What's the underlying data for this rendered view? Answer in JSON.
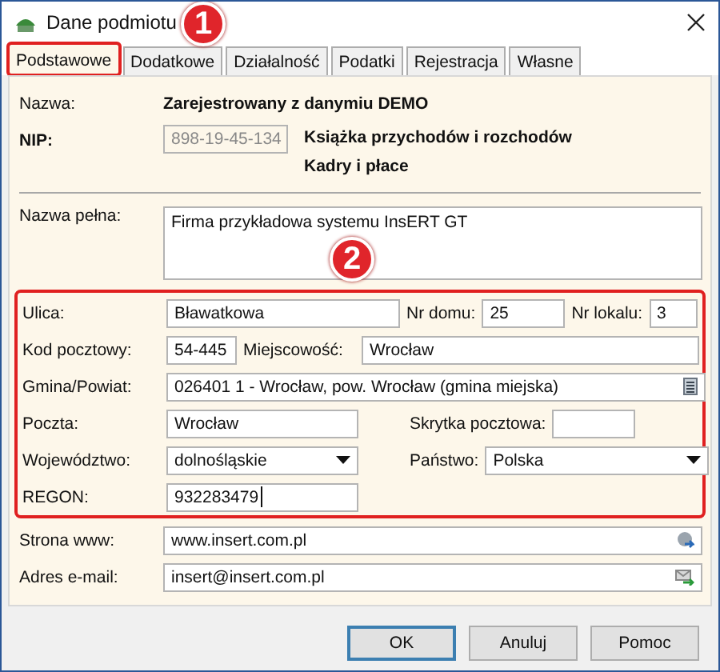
{
  "window": {
    "title": "Dane podmiotu"
  },
  "tabs": [
    {
      "label": "Podstawowe",
      "selected": true,
      "highlighted": true
    },
    {
      "label": "Dodatkowe",
      "selected": false,
      "highlighted": false
    },
    {
      "label": "Działalność",
      "selected": false,
      "highlighted": false
    },
    {
      "label": "Podatki",
      "selected": false,
      "highlighted": false
    },
    {
      "label": "Rejestracja",
      "selected": false,
      "highlighted": false
    },
    {
      "label": "Własne",
      "selected": false,
      "highlighted": false
    }
  ],
  "callouts": [
    "1",
    "2"
  ],
  "header": {
    "name_label": "Nazwa:",
    "name": "Zarejestrowany z danymiu DEMO",
    "nip_label": "NIP:",
    "nip": "898-19-45-134",
    "nip_disabled": true,
    "modules": [
      "Książka przychodów i rozchodów",
      "Kadry i płace"
    ]
  },
  "full_name": {
    "label": "Nazwa pełna:",
    "value": "Firma przykładowa systemu InsERT GT"
  },
  "address": {
    "highlighted": true,
    "street": {
      "label": "Ulica:",
      "value": "Bławatkowa"
    },
    "house_no": {
      "label": "Nr domu:",
      "value": "25"
    },
    "flat_no": {
      "label": "Nr lokalu:",
      "value": "3"
    },
    "postal_code": {
      "label": "Kod pocztowy:",
      "value": "54-445"
    },
    "city": {
      "label": "Miejscowość:",
      "value": "Wrocław"
    },
    "commune": {
      "label": "Gmina/Powiat:",
      "value": "026401 1 - Wrocław, pow. Wrocław (gmina miejska)"
    },
    "post_office": {
      "label": "Poczta:",
      "value": "Wrocław"
    },
    "po_box": {
      "label": "Skrytka pocztowa:"
    },
    "voivodeship": {
      "label": "Województwo:",
      "value": "dolnośląskie"
    },
    "country": {
      "label": "Państwo:",
      "value": "Polska"
    },
    "regon": {
      "label": "REGON:",
      "value": "932283479",
      "focused": true
    }
  },
  "contacts": {
    "website": {
      "label": "Strona www:",
      "value": "www.insert.com.pl"
    },
    "email": {
      "label": "Adres e-mail:",
      "value": "insert@insert.com.pl"
    }
  },
  "buttons": [
    "OK",
    "Anuluj",
    "Pomoc"
  ]
}
